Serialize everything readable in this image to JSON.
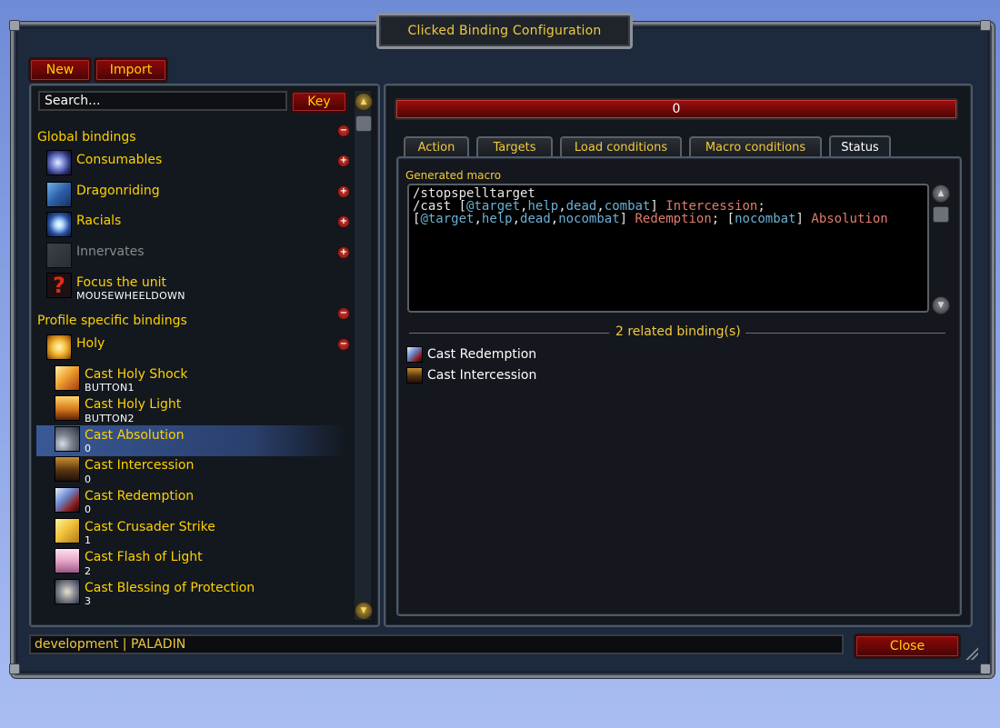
{
  "window": {
    "title": "Clicked Binding Configuration"
  },
  "toolbar": {
    "new_label": "New",
    "import_label": "Import"
  },
  "search": {
    "placeholder": "Search...",
    "key_label": "Key"
  },
  "tree": {
    "global_header": "Global bindings",
    "global_items": [
      {
        "name": "Consumables",
        "toggle": "+",
        "icon": "consumables-icon"
      },
      {
        "name": "Dragonriding",
        "toggle": "+",
        "icon": "dragonriding-icon"
      },
      {
        "name": "Racials",
        "toggle": "+",
        "icon": "racials-icon"
      },
      {
        "name": "Innervates",
        "toggle": "+",
        "icon": "innervates-icon",
        "disabled": true
      },
      {
        "name": "Focus the unit",
        "sub": "MOUSEWHEELDOWN",
        "icon": "question-mark-icon"
      }
    ],
    "profile_header": "Profile specific bindings",
    "holy_group": {
      "name": "Holy",
      "toggle": "−"
    },
    "holy_items": [
      {
        "name": "Cast Holy Shock",
        "sub": "BUTTON1"
      },
      {
        "name": "Cast Holy Light",
        "sub": "BUTTON2"
      },
      {
        "name": "Cast Absolution",
        "sub": "0",
        "selected": true
      },
      {
        "name": "Cast Intercession",
        "sub": "0"
      },
      {
        "name": "Cast Redemption",
        "sub": "0"
      },
      {
        "name": "Cast Crusader Strike",
        "sub": "1"
      },
      {
        "name": "Cast Flash of Light",
        "sub": "2"
      },
      {
        "name": "Cast Blessing of Protection",
        "sub": "3"
      }
    ]
  },
  "right": {
    "binding_key": "0",
    "tabs": [
      "Action",
      "Targets",
      "Load conditions",
      "Macro conditions",
      "Status"
    ],
    "active_tab": "Status",
    "macro_label": "Generated macro",
    "macro": {
      "line1": "/stopspelltarget",
      "line2_a": "/cast [",
      "line2_b": "@target",
      "line2_c": ",",
      "line2_d": "help",
      "line2_e": ",",
      "line2_f": "dead",
      "line2_g": ",",
      "line2_h": "combat",
      "line2_i": "] ",
      "line2_j": "Intercession",
      "line2_k": ";",
      "line3_a": "[",
      "line3_b": "@target",
      "line3_c": ",",
      "line3_d": "help",
      "line3_e": ",",
      "line3_f": "dead",
      "line3_g": ",",
      "line3_h": "nocombat",
      "line3_i": "] ",
      "line3_j": "Redemption",
      "line3_k": "; [",
      "line3_l": "nocombat",
      "line3_m": "] ",
      "line3_n": "Absolution"
    },
    "related_label": "2 related binding(s)",
    "related": [
      "Cast Redemption",
      "Cast Intercession"
    ]
  },
  "footer": {
    "status": "development | PALADIN",
    "close_label": "Close"
  }
}
